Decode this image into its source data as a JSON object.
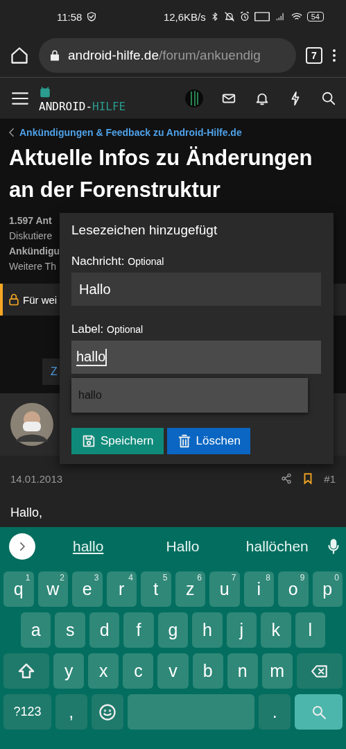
{
  "status_bar": {
    "time": "11:58",
    "speed": "12,6KB/s",
    "battery": "54"
  },
  "browser": {
    "url_host": "android-hilfe.de",
    "url_path": "/forum/ankuendig",
    "tab_count": "7"
  },
  "site_header": {
    "logo_left": "ANDROID-",
    "logo_right": "HILFE"
  },
  "breadcrumb": "Ankündigungen & Feedback zu Android-Hilfe.de",
  "title": "Aktuelle Infos zu Änderungen an der Forenstruktur",
  "meta": [
    {
      "text": "1.597 Ant",
      "bold": true
    },
    {
      "text": "Diskutiere",
      "bold": false
    },
    {
      "text": "Ankündigu",
      "bold": true
    },
    {
      "text": "Weitere Th",
      "bold": false
    }
  ],
  "notice": "Für wei",
  "jump_button": "Z",
  "post": {
    "date": "14.01.2013",
    "bookmarked": true,
    "number": "#1",
    "body": "Hallo,"
  },
  "bookmark_popup": {
    "title": "Lesezeichen hinzugefügt",
    "fields": [
      {
        "label": "Nachricht:",
        "hint": "Optional",
        "value": "Hallo",
        "focused": false
      },
      {
        "label": "Label:",
        "hint": "Optional",
        "value": "hallo",
        "focused": true
      }
    ],
    "suggestions": [
      "hallo"
    ],
    "buttons": [
      {
        "kind": "save",
        "label": "Speichern"
      },
      {
        "kind": "delete",
        "label": "Löschen"
      }
    ]
  },
  "keyboard": {
    "suggestions": [
      {
        "text": "hallo",
        "selected": true
      },
      {
        "text": "Hallo",
        "selected": false
      },
      {
        "text": "hallöchen",
        "selected": false
      }
    ],
    "rows": [
      {
        "keys": [
          {
            "kind": "letter",
            "label": "q",
            "hint": "1"
          },
          {
            "kind": "letter",
            "label": "w",
            "hint": "2"
          },
          {
            "kind": "letter",
            "label": "e",
            "hint": "3"
          },
          {
            "kind": "letter",
            "label": "r",
            "hint": "4"
          },
          {
            "kind": "letter",
            "label": "t",
            "hint": "5"
          },
          {
            "kind": "letter",
            "label": "z",
            "hint": "6"
          },
          {
            "kind": "letter",
            "label": "u",
            "hint": "7"
          },
          {
            "kind": "letter",
            "label": "i",
            "hint": "8"
          },
          {
            "kind": "letter",
            "label": "o",
            "hint": "9"
          },
          {
            "kind": "letter",
            "label": "p",
            "hint": "0"
          }
        ]
      },
      {
        "keys": [
          {
            "kind": "letter",
            "label": "a"
          },
          {
            "kind": "letter",
            "label": "s"
          },
          {
            "kind": "letter",
            "label": "d"
          },
          {
            "kind": "letter",
            "label": "f"
          },
          {
            "kind": "letter",
            "label": "g"
          },
          {
            "kind": "letter",
            "label": "h"
          },
          {
            "kind": "letter",
            "label": "j"
          },
          {
            "kind": "letter",
            "label": "k"
          },
          {
            "kind": "letter",
            "label": "l"
          }
        ]
      },
      {
        "keys": [
          {
            "kind": "shift"
          },
          {
            "kind": "letter",
            "label": "y"
          },
          {
            "kind": "letter",
            "label": "x"
          },
          {
            "kind": "letter",
            "label": "c"
          },
          {
            "kind": "letter",
            "label": "v"
          },
          {
            "kind": "letter",
            "label": "b"
          },
          {
            "kind": "letter",
            "label": "n"
          },
          {
            "kind": "letter",
            "label": "m"
          },
          {
            "kind": "backspace"
          }
        ]
      },
      {
        "keys": [
          {
            "kind": "symbols",
            "label": "?123"
          },
          {
            "kind": "punct",
            "label": ","
          },
          {
            "kind": "emoji"
          },
          {
            "kind": "space"
          },
          {
            "kind": "punct",
            "label": "."
          },
          {
            "kind": "search"
          }
        ]
      }
    ]
  }
}
